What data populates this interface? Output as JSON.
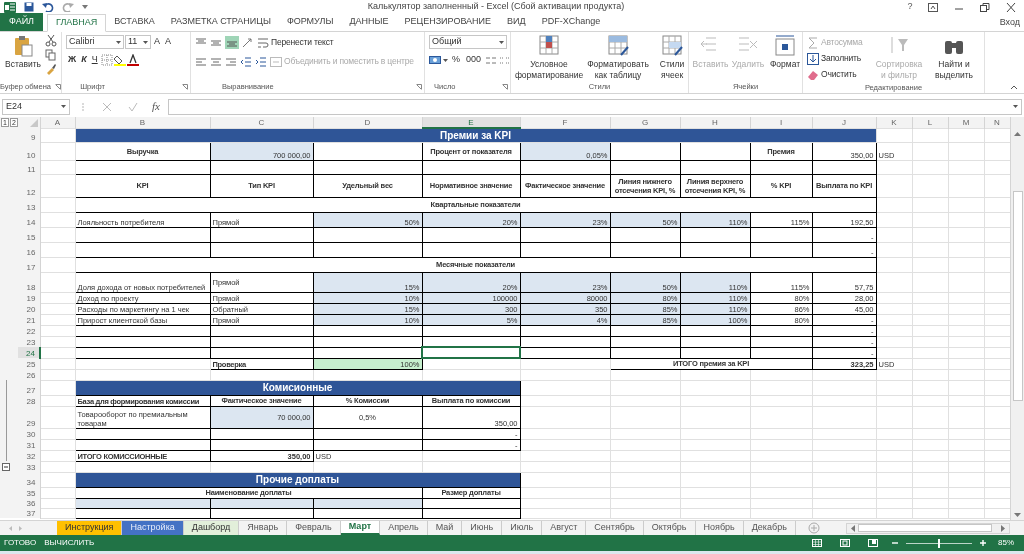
{
  "window": {
    "title": "Калькулятор заполненный - Excel (Сбой активации продукта)",
    "help": "?"
  },
  "ribbon_tabs": [
    {
      "label": "ФАЙЛ",
      "kind": "file",
      "selected": false
    },
    {
      "label": "ГЛАВНАЯ",
      "kind": "tab",
      "selected": true
    },
    {
      "label": "ВСТАВКА",
      "kind": "tab",
      "selected": false
    },
    {
      "label": "РАЗМЕТКА СТРАНИЦЫ",
      "kind": "tab",
      "selected": false
    },
    {
      "label": "ФОРМУЛЫ",
      "kind": "tab",
      "selected": false
    },
    {
      "label": "ДАННЫЕ",
      "kind": "tab",
      "selected": false
    },
    {
      "label": "РЕЦЕНЗИРОВАНИЕ",
      "kind": "tab",
      "selected": false
    },
    {
      "label": "ВИД",
      "kind": "tab",
      "selected": false
    },
    {
      "label": "PDF-XChange",
      "kind": "tab",
      "selected": false
    }
  ],
  "account": "Вход",
  "ribbon_groups": [
    {
      "label": "Буфер обмена",
      "controls": [
        {
          "kind": "large",
          "label": "Вставить",
          "disabled": false
        }
      ]
    },
    {
      "label": "Шрифт",
      "controls": [
        {
          "kind": "field",
          "value": "Calibri"
        },
        {
          "kind": "field",
          "value": "11"
        },
        {
          "kind": "glyph",
          "label": "A"
        },
        {
          "kind": "glyph",
          "label": "A"
        },
        {
          "kind": "glyph",
          "label": "Ж"
        },
        {
          "kind": "glyph",
          "label": "К"
        },
        {
          "kind": "glyph",
          "label": "Ч"
        }
      ]
    },
    {
      "label": "Выравнивание",
      "controls": [
        {
          "kind": "small",
          "label": "Перенести текст",
          "disabled": false
        },
        {
          "kind": "small",
          "label": "Объединить и поместить в центре",
          "disabled": true
        }
      ]
    },
    {
      "label": "Число",
      "controls": [
        {
          "kind": "field",
          "value": "Общий"
        },
        {
          "kind": "glyph",
          "label": "%"
        },
        {
          "kind": "glyph",
          "label": "000"
        }
      ]
    },
    {
      "label": "Стили",
      "controls": [
        {
          "kind": "large",
          "label": "Условное форматирование",
          "disabled": false
        },
        {
          "kind": "large",
          "label": "Форматировать как таблицу",
          "disabled": false
        },
        {
          "kind": "large",
          "label": "Стили ячеек",
          "disabled": false
        }
      ]
    },
    {
      "label": "Ячейки",
      "controls": [
        {
          "kind": "large",
          "label": "Вставить",
          "disabled": true
        },
        {
          "kind": "large",
          "label": "Удалить",
          "disabled": true
        },
        {
          "kind": "large",
          "label": "Формат",
          "disabled": false
        }
      ]
    },
    {
      "label": "Редактирование",
      "controls": [
        {
          "kind": "small",
          "label": "Автосумма",
          "disabled": true
        },
        {
          "kind": "small",
          "label": "Заполнить",
          "disabled": false
        },
        {
          "kind": "small",
          "label": "Очистить",
          "disabled": false
        },
        {
          "kind": "large",
          "label": "Сортировка и фильтр",
          "disabled": true
        },
        {
          "kind": "large",
          "label": "Найти и выделить",
          "disabled": false
        }
      ]
    }
  ],
  "formula_bar": {
    "name_box": "E24",
    "fx": "fx"
  },
  "outline_levels": [
    "1",
    "2"
  ],
  "columns": [
    {
      "label": "A",
      "selected": false
    },
    {
      "label": "B",
      "selected": false
    },
    {
      "label": "C",
      "selected": false
    },
    {
      "label": "D",
      "selected": false
    },
    {
      "label": "E",
      "selected": true
    },
    {
      "label": "F",
      "selected": false
    },
    {
      "label": "G",
      "selected": false
    },
    {
      "label": "H",
      "selected": false
    },
    {
      "label": "I",
      "selected": false
    },
    {
      "label": "J",
      "selected": false
    },
    {
      "label": "K",
      "selected": false
    },
    {
      "label": "L",
      "selected": false
    },
    {
      "label": "M",
      "selected": false
    },
    {
      "label": "N",
      "selected": false
    }
  ],
  "rows": [
    {
      "number": "9",
      "selected": false,
      "cells": {
        "B": {
          "text": "Премии за KPI",
          "kind": "band"
        }
      }
    },
    {
      "number": "10",
      "selected": false,
      "cells": {
        "B": {
          "text": "Выручка",
          "kind": "header"
        },
        "C": {
          "text": "700 000,00",
          "kind": "input"
        },
        "E": {
          "text": "Процент от показателя",
          "kind": "header"
        },
        "F": {
          "text": "0,05%",
          "kind": "input"
        },
        "I": {
          "text": "Премия",
          "kind": "header"
        },
        "J": {
          "text": "350,00",
          "kind": "value"
        },
        "K": {
          "text": "USD",
          "kind": "label"
        }
      }
    },
    {
      "number": "11",
      "selected": false,
      "cells": {}
    },
    {
      "number": "12",
      "selected": false,
      "cells": {
        "B": {
          "text": "KPI",
          "kind": "header"
        },
        "C": {
          "text": "Тип KPI",
          "kind": "header"
        },
        "D": {
          "text": "Удельный вес",
          "kind": "header"
        },
        "E": {
          "text": "Нормативное значение",
          "kind": "header"
        },
        "F": {
          "text": "Фактическое значение",
          "kind": "header"
        },
        "G": {
          "text": "Линия нижнего отсечения KPI, %",
          "kind": "header"
        },
        "H": {
          "text": "Линия верхнего отсечения KPI, %",
          "kind": "header"
        },
        "I": {
          "text": "% KPI",
          "kind": "header"
        },
        "J": {
          "text": "Выплата по KPI",
          "kind": "header"
        }
      }
    },
    {
      "number": "13",
      "selected": false,
      "cells": {
        "B": {
          "text": "Квартальные показатели",
          "kind": "header"
        }
      }
    },
    {
      "number": "14",
      "selected": false,
      "cells": {
        "B": {
          "text": "Лояльность потребителя",
          "kind": "label"
        },
        "C": {
          "text": "Прямой",
          "kind": "label"
        },
        "D": {
          "text": "50%",
          "kind": "input"
        },
        "E": {
          "text": "20%",
          "kind": "input"
        },
        "F": {
          "text": "23%",
          "kind": "input"
        },
        "G": {
          "text": "50%",
          "kind": "input"
        },
        "H": {
          "text": "110%",
          "kind": "input"
        },
        "I": {
          "text": "115%",
          "kind": "value"
        },
        "J": {
          "text": "192,50",
          "kind": "value"
        }
      }
    },
    {
      "number": "15",
      "selected": false,
      "cells": {
        "J": {
          "text": "-",
          "kind": "value"
        }
      }
    },
    {
      "number": "16",
      "selected": false,
      "cells": {
        "J": {
          "text": "-",
          "kind": "value"
        }
      }
    },
    {
      "number": "17",
      "selected": false,
      "cells": {
        "B": {
          "text": "Месячные показатели",
          "kind": "header"
        }
      }
    },
    {
      "number": "18",
      "selected": false,
      "cells": {
        "B": {
          "text": "Доля дохода от новых потребителей",
          "kind": "label"
        },
        "C": {
          "text": "Прямой",
          "kind": "middle"
        },
        "D": {
          "text": "15%",
          "kind": "input"
        },
        "E": {
          "text": "20%",
          "kind": "input"
        },
        "F": {
          "text": "23%",
          "kind": "input"
        },
        "G": {
          "text": "50%",
          "kind": "input"
        },
        "H": {
          "text": "110%",
          "kind": "input"
        },
        "I": {
          "text": "115%",
          "kind": "value"
        },
        "J": {
          "text": "57,75",
          "kind": "value"
        }
      }
    },
    {
      "number": "19",
      "selected": false,
      "cells": {
        "B": {
          "text": "Доход по проекту",
          "kind": "label"
        },
        "C": {
          "text": "Прямой",
          "kind": "label"
        },
        "D": {
          "text": "10%",
          "kind": "input"
        },
        "E": {
          "text": "100000",
          "kind": "input"
        },
        "F": {
          "text": "80000",
          "kind": "input"
        },
        "G": {
          "text": "80%",
          "kind": "input"
        },
        "H": {
          "text": "110%",
          "kind": "input"
        },
        "I": {
          "text": "80%",
          "kind": "value"
        },
        "J": {
          "text": "28,00",
          "kind": "value"
        }
      }
    },
    {
      "number": "20",
      "selected": false,
      "cells": {
        "B": {
          "text": "Расходы по маркетингу на 1 чек",
          "kind": "label"
        },
        "C": {
          "text": "Обратный",
          "kind": "label"
        },
        "D": {
          "text": "15%",
          "kind": "input"
        },
        "E": {
          "text": "300",
          "kind": "input"
        },
        "F": {
          "text": "350",
          "kind": "input"
        },
        "G": {
          "text": "85%",
          "kind": "input"
        },
        "H": {
          "text": "110%",
          "kind": "input"
        },
        "I": {
          "text": "86%",
          "kind": "value"
        },
        "J": {
          "text": "45,00",
          "kind": "value"
        }
      }
    },
    {
      "number": "21",
      "selected": false,
      "cells": {
        "B": {
          "text": "Прирост клиентской базы",
          "kind": "label"
        },
        "C": {
          "text": "Прямой",
          "kind": "label"
        },
        "D": {
          "text": "10%",
          "kind": "input"
        },
        "E": {
          "text": "5%",
          "kind": "input"
        },
        "F": {
          "text": "4%",
          "kind": "input"
        },
        "G": {
          "text": "85%",
          "kind": "input"
        },
        "H": {
          "text": "100%",
          "kind": "input"
        },
        "I": {
          "text": "80%",
          "kind": "value"
        },
        "J": {
          "text": "-",
          "kind": "value"
        }
      }
    },
    {
      "number": "22",
      "selected": false,
      "cells": {
        "J": {
          "text": "-",
          "kind": "value"
        }
      }
    },
    {
      "number": "23",
      "selected": false,
      "cells": {
        "J": {
          "text": "-",
          "kind": "value"
        }
      }
    },
    {
      "number": "24",
      "selected": true,
      "cells": {
        "J": {
          "text": "-",
          "kind": "value"
        }
      }
    },
    {
      "number": "25",
      "selected": false,
      "cells": {
        "C": {
          "text": "Проверка",
          "kind": "total_label"
        },
        "D": {
          "text": "100%",
          "kind": "ok"
        },
        "G": {
          "text": "ИТОГО премия за KPI",
          "kind": "header"
        },
        "J": {
          "text": "323,25",
          "kind": "total_value"
        },
        "K": {
          "text": "USD",
          "kind": "label"
        }
      }
    },
    {
      "number": "26",
      "selected": false,
      "cells": {}
    },
    {
      "number": "27",
      "selected": false,
      "cells": {
        "B": {
          "text": "Комисионные",
          "kind": "band"
        }
      }
    },
    {
      "number": "28",
      "selected": false,
      "cells": {
        "B": {
          "text": "База для формирования комиссии",
          "kind": "total_label"
        },
        "C": {
          "text": "Фактическое значение",
          "kind": "header"
        },
        "D": {
          "text": "% Комиссии",
          "kind": "header"
        },
        "E": {
          "text": "Выплата по комиссии",
          "kind": "header"
        }
      }
    },
    {
      "number": "29",
      "selected": false,
      "cells": {
        "B": {
          "text": "Товарооборот по премиальным товарам",
          "kind": "label"
        },
        "C": {
          "text": "70 000,00",
          "kind": "input_middle"
        },
        "D": {
          "text": "0,5%",
          "kind": "center"
        },
        "E": {
          "text": "350,00",
          "kind": "value"
        }
      }
    },
    {
      "number": "30",
      "selected": false,
      "cells": {
        "E": {
          "text": "-",
          "kind": "value"
        }
      }
    },
    {
      "number": "31",
      "selected": false,
      "cells": {
        "E": {
          "text": "-",
          "kind": "value"
        }
      }
    },
    {
      "number": "32",
      "selected": false,
      "cells": {
        "B": {
          "text": "ИТОГО КОМИССИОННЫЕ",
          "kind": "total_label"
        },
        "C": {
          "text": "350,00",
          "kind": "total_value"
        },
        "D": {
          "text": "USD",
          "kind": "label"
        }
      }
    },
    {
      "number": "33",
      "selected": false,
      "cells": {}
    },
    {
      "number": "34",
      "selected": false,
      "cells": {
        "B": {
          "text": "Прочие доплаты",
          "kind": "band"
        }
      }
    },
    {
      "number": "35",
      "selected": false,
      "cells": {
        "B": {
          "text": "Наименование доплаты",
          "kind": "header"
        },
        "E": {
          "text": "Размер доплаты",
          "kind": "header"
        }
      }
    },
    {
      "number": "36",
      "selected": false,
      "cells": {}
    },
    {
      "number": "37",
      "selected": false,
      "cells": {}
    }
  ],
  "sheet_tabs": [
    {
      "label": "Инструкция",
      "selected": false,
      "color": "#ffc000"
    },
    {
      "label": "Настройка",
      "selected": false,
      "color": "#4472c4"
    },
    {
      "label": "Дашборд",
      "selected": false,
      "color": "#e2efda"
    },
    {
      "label": "Январь",
      "selected": false
    },
    {
      "label": "Февраль",
      "selected": false
    },
    {
      "label": "Март",
      "selected": true
    },
    {
      "label": "Апрель",
      "selected": false
    },
    {
      "label": "Май",
      "selected": false
    },
    {
      "label": "Июнь",
      "selected": false
    },
    {
      "label": "Июль",
      "selected": false
    },
    {
      "label": "Август",
      "selected": false
    },
    {
      "label": "Сентябрь",
      "selected": false
    },
    {
      "label": "Октябрь",
      "selected": false
    },
    {
      "label": "Ноябрь",
      "selected": false
    },
    {
      "label": "Декабрь",
      "selected": false
    }
  ],
  "status_bar": {
    "items": [
      "ГОТОВО",
      "ВЫЧИСЛИТЬ"
    ],
    "zoom": "85%",
    "zoom_level": {
      "level": 0.5
    }
  }
}
